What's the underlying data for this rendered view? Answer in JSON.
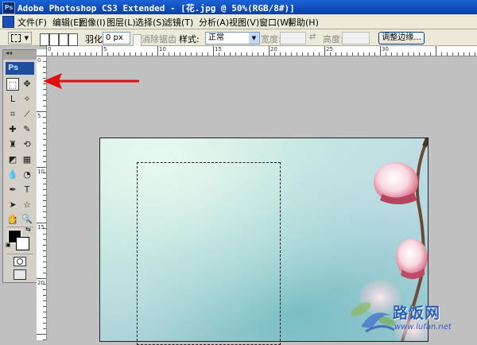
{
  "window": {
    "app_icon": "Ps",
    "title": "Adobe Photoshop CS3 Extended - [花.jpg @ 50%(RGB/8#)]"
  },
  "menu": [
    "文件(F)",
    "编辑(E)",
    "图像(I)",
    "图层(L)",
    "选择(S)",
    "滤镜(T)",
    "分析(A)",
    "视图(V)",
    "窗口(W)",
    "帮助(H)"
  ],
  "options": {
    "feather_label": "羽化:",
    "feather_value": "0 px",
    "antialias_label": "消除锯齿",
    "style_label": "样式:",
    "style_value": "正常",
    "width_label": "宽度:",
    "height_label": "高度:",
    "refine_edge_button": "调整边缘..."
  },
  "toolbox": {
    "logo": "Ps",
    "collapse_glyph": "◂◂",
    "tools": [
      {
        "name": "rectangular-marquee-tool-icon",
        "glyph": "⬚",
        "selected": true
      },
      {
        "name": "move-tool-icon",
        "glyph": "✥"
      },
      {
        "name": "lasso-tool-icon",
        "glyph": "ᒪ"
      },
      {
        "name": "magic-wand-tool-icon",
        "glyph": "✧"
      },
      {
        "name": "crop-tool-icon",
        "glyph": "⌗"
      },
      {
        "name": "slice-tool-icon",
        "glyph": "⟋"
      },
      {
        "name": "healing-brush-tool-icon",
        "glyph": "✚"
      },
      {
        "name": "brush-tool-icon",
        "glyph": "✎"
      },
      {
        "name": "clone-stamp-tool-icon",
        "glyph": "♜"
      },
      {
        "name": "history-brush-tool-icon",
        "glyph": "⟲"
      },
      {
        "name": "eraser-tool-icon",
        "glyph": "◩"
      },
      {
        "name": "gradient-tool-icon",
        "glyph": "▦"
      },
      {
        "name": "blur-tool-icon",
        "glyph": "💧"
      },
      {
        "name": "dodge-tool-icon",
        "glyph": "◔"
      },
      {
        "name": "pen-tool-icon",
        "glyph": "✒"
      },
      {
        "name": "type-tool-icon",
        "glyph": "T"
      },
      {
        "name": "path-selection-tool-icon",
        "glyph": "➤"
      },
      {
        "name": "shape-tool-icon",
        "glyph": "☆"
      },
      {
        "name": "notes-tool-icon",
        "glyph": "▤"
      },
      {
        "name": "eyedropper-tool-icon",
        "glyph": "⟊"
      },
      {
        "name": "hand-tool-icon",
        "glyph": "✋"
      },
      {
        "name": "zoom-tool-icon",
        "glyph": "🔍"
      }
    ]
  },
  "rulers": {
    "horizontal": [
      "0",
      "5",
      "10",
      "15",
      "20",
      "25",
      "30"
    ],
    "vertical": [
      "0",
      "5",
      "10",
      "15",
      "20"
    ]
  },
  "document": {
    "zoom": "50%",
    "file": "花.jpg"
  },
  "watermark": {
    "text": "路饭网",
    "url": "www.lufan.net"
  },
  "colors": {
    "annotation_arrow": "#e01010",
    "titlebar": "#0a3fa8"
  }
}
